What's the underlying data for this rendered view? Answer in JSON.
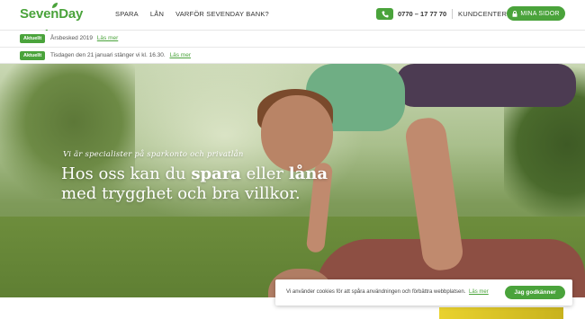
{
  "brand": {
    "name": "SevenDay Bank",
    "accent": "#4aa33b"
  },
  "nav": {
    "items": [
      "SPARA",
      "LÅN",
      "VARFÖR SEVENDAY BANK?"
    ]
  },
  "header": {
    "phone": "0770 – 17 77 70",
    "kundcenter": "KUNDCENTER",
    "mina_sidor": "MINA SIDOR"
  },
  "notices": [
    {
      "badge": "Aktuellt",
      "text": "Årsbesked 2019",
      "link": "Läs mer"
    },
    {
      "badge": "Aktuellt",
      "text": "Tisdagen den 21 januari stänger vi kl. 16.30.",
      "link": "Läs mer"
    }
  ],
  "hero": {
    "kicker": "Vi är specialister på sparkonto och privatlån",
    "title_part1": "Hos oss kan du ",
    "title_bold1": "spara",
    "title_part2": " eller ",
    "title_bold2": "låna",
    "title_part3": " med trygghet och bra villkor."
  },
  "cookie": {
    "text": "Vi använder cookies för att spåra användningen och förbättra webbplatsen.",
    "link": "Läs mer",
    "button": "Jag godkänner"
  }
}
